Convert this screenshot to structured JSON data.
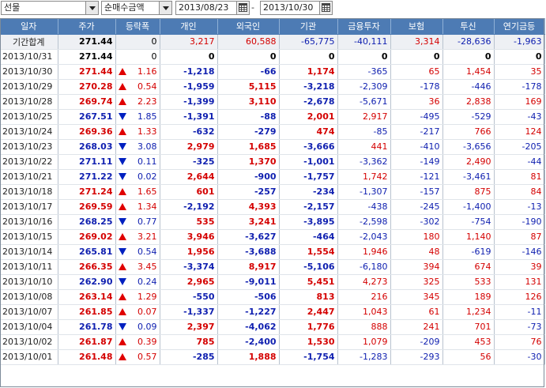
{
  "toolbar": {
    "market": "선물",
    "measure": "순매수금액",
    "date_from": "2013/08/23",
    "separator": "-",
    "date_to": "2013/10/30"
  },
  "columns": [
    "일자",
    "주가",
    "등락폭",
    "개인",
    "외국인",
    "기관",
    "금융투자",
    "보험",
    "투신",
    "연기금등"
  ],
  "summary": {
    "label": "기간합계",
    "price": "271.44",
    "change": "0",
    "individual": "3,217",
    "foreign": "60,588",
    "institution": "-65,775",
    "fin_invest": "-40,111",
    "insurance": "3,314",
    "trust": "-28,636",
    "pension": "-1,963"
  },
  "rows": [
    {
      "date": "2013/10/31",
      "price": "271.44",
      "dir": "none",
      "change": "0",
      "individual": "0",
      "foreign": "0",
      "institution": "0",
      "fin_invest": "0",
      "insurance": "0",
      "trust": "0",
      "pension": "0"
    },
    {
      "date": "2013/10/30",
      "price": "271.44",
      "dir": "up",
      "change": "1.16",
      "individual": "-1,218",
      "foreign": "-66",
      "institution": "1,174",
      "fin_invest": "-365",
      "insurance": "65",
      "trust": "1,454",
      "pension": "35"
    },
    {
      "date": "2013/10/29",
      "price": "270.28",
      "dir": "up",
      "change": "0.54",
      "individual": "-1,959",
      "foreign": "5,115",
      "institution": "-3,218",
      "fin_invest": "-2,309",
      "insurance": "-178",
      "trust": "-446",
      "pension": "-178"
    },
    {
      "date": "2013/10/28",
      "price": "269.74",
      "dir": "up",
      "change": "2.23",
      "individual": "-1,399",
      "foreign": "3,110",
      "institution": "-2,678",
      "fin_invest": "-5,671",
      "insurance": "36",
      "trust": "2,838",
      "pension": "169"
    },
    {
      "date": "2013/10/25",
      "price": "267.51",
      "dir": "down",
      "change": "1.85",
      "individual": "-1,391",
      "foreign": "-88",
      "institution": "2,001",
      "fin_invest": "2,917",
      "insurance": "-495",
      "trust": "-529",
      "pension": "-43"
    },
    {
      "date": "2013/10/24",
      "price": "269.36",
      "dir": "up",
      "change": "1.33",
      "individual": "-632",
      "foreign": "-279",
      "institution": "474",
      "fin_invest": "-85",
      "insurance": "-217",
      "trust": "766",
      "pension": "124"
    },
    {
      "date": "2013/10/23",
      "price": "268.03",
      "dir": "down",
      "change": "3.08",
      "individual": "2,979",
      "foreign": "1,685",
      "institution": "-3,666",
      "fin_invest": "441",
      "insurance": "-410",
      "trust": "-3,656",
      "pension": "-205"
    },
    {
      "date": "2013/10/22",
      "price": "271.11",
      "dir": "down",
      "change": "0.11",
      "individual": "-325",
      "foreign": "1,370",
      "institution": "-1,001",
      "fin_invest": "-3,362",
      "insurance": "-149",
      "trust": "2,490",
      "pension": "-44"
    },
    {
      "date": "2013/10/21",
      "price": "271.22",
      "dir": "down",
      "change": "0.02",
      "individual": "2,644",
      "foreign": "-900",
      "institution": "-1,757",
      "fin_invest": "1,742",
      "insurance": "-121",
      "trust": "-3,461",
      "pension": "81"
    },
    {
      "date": "2013/10/18",
      "price": "271.24",
      "dir": "up",
      "change": "1.65",
      "individual": "601",
      "foreign": "-257",
      "institution": "-234",
      "fin_invest": "-1,307",
      "insurance": "-157",
      "trust": "875",
      "pension": "84"
    },
    {
      "date": "2013/10/17",
      "price": "269.59",
      "dir": "up",
      "change": "1.34",
      "individual": "-2,192",
      "foreign": "4,393",
      "institution": "-2,157",
      "fin_invest": "-438",
      "insurance": "-245",
      "trust": "-1,400",
      "pension": "-13"
    },
    {
      "date": "2013/10/16",
      "price": "268.25",
      "dir": "down",
      "change": "0.77",
      "individual": "535",
      "foreign": "3,241",
      "institution": "-3,895",
      "fin_invest": "-2,598",
      "insurance": "-302",
      "trust": "-754",
      "pension": "-190"
    },
    {
      "date": "2013/10/15",
      "price": "269.02",
      "dir": "up",
      "change": "3.21",
      "individual": "3,946",
      "foreign": "-3,627",
      "institution": "-464",
      "fin_invest": "-2,043",
      "insurance": "180",
      "trust": "1,140",
      "pension": "87"
    },
    {
      "date": "2013/10/14",
      "price": "265.81",
      "dir": "down",
      "change": "0.54",
      "individual": "1,956",
      "foreign": "-3,688",
      "institution": "1,554",
      "fin_invest": "1,946",
      "insurance": "48",
      "trust": "-619",
      "pension": "-146"
    },
    {
      "date": "2013/10/11",
      "price": "266.35",
      "dir": "up",
      "change": "3.45",
      "individual": "-3,374",
      "foreign": "8,917",
      "institution": "-5,106",
      "fin_invest": "-6,180",
      "insurance": "394",
      "trust": "674",
      "pension": "39"
    },
    {
      "date": "2013/10/10",
      "price": "262.90",
      "dir": "down",
      "change": "0.24",
      "individual": "2,965",
      "foreign": "-9,011",
      "institution": "5,451",
      "fin_invest": "4,273",
      "insurance": "325",
      "trust": "533",
      "pension": "131"
    },
    {
      "date": "2013/10/08",
      "price": "263.14",
      "dir": "up",
      "change": "1.29",
      "individual": "-550",
      "foreign": "-506",
      "institution": "813",
      "fin_invest": "216",
      "insurance": "345",
      "trust": "189",
      "pension": "126"
    },
    {
      "date": "2013/10/07",
      "price": "261.85",
      "dir": "up",
      "change": "0.07",
      "individual": "-1,337",
      "foreign": "-1,227",
      "institution": "2,447",
      "fin_invest": "1,043",
      "insurance": "61",
      "trust": "1,234",
      "pension": "-11"
    },
    {
      "date": "2013/10/04",
      "price": "261.78",
      "dir": "down",
      "change": "0.09",
      "individual": "2,397",
      "foreign": "-4,062",
      "institution": "1,776",
      "fin_invest": "888",
      "insurance": "241",
      "trust": "701",
      "pension": "-73"
    },
    {
      "date": "2013/10/02",
      "price": "261.87",
      "dir": "up",
      "change": "0.39",
      "individual": "785",
      "foreign": "-2,400",
      "institution": "1,530",
      "fin_invest": "1,079",
      "insurance": "-209",
      "trust": "453",
      "pension": "76"
    },
    {
      "date": "2013/10/01",
      "price": "261.48",
      "dir": "up",
      "change": "0.57",
      "individual": "-285",
      "foreign": "1,888",
      "institution": "-1,754",
      "fin_invest": "-1,283",
      "insurance": "-293",
      "trust": "56",
      "pension": "-30"
    }
  ],
  "colors": {
    "header_bg": "#4d7bb4",
    "up": "#d40000",
    "down": "#1020b0"
  }
}
